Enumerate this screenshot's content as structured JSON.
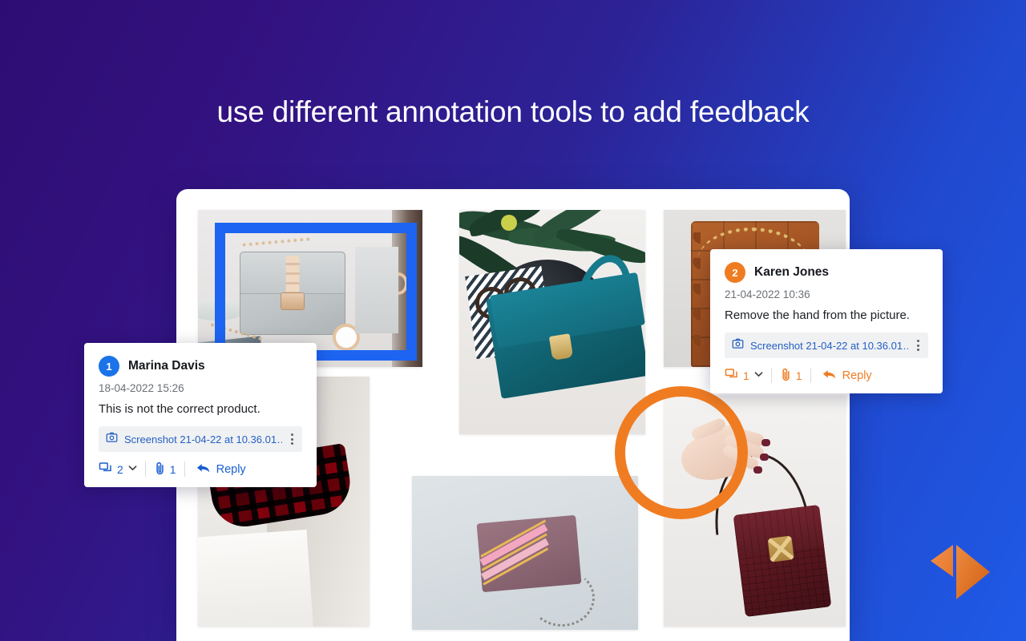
{
  "headline": "use different annotation tools to add feedback",
  "brand": {
    "accent_blue": "#1d64f2",
    "accent_orange": "#f07c22",
    "bg_from": "#2e0d73",
    "bg_to": "#1f5ae6",
    "logo_name": "logo-mark"
  },
  "annotations": [
    {
      "type": "rectangle",
      "color": "#1d64f2",
      "target": "grey-studded-bag-photo"
    },
    {
      "type": "circle",
      "color": "#f07c22",
      "target": "hand-holding-maroon-bag-photo"
    }
  ],
  "gallery": {
    "images": [
      {
        "name": "grey-studded-chain-bag",
        "alt": "Grey studded flap bag with chain on desk"
      },
      {
        "name": "teal-leather-bag",
        "alt": "Teal leather handbag with glasses and plant"
      },
      {
        "name": "brown-woven-tote",
        "alt": "Brown woven leather tote with gold chain"
      },
      {
        "name": "red-plaid-clutch",
        "alt": "Red and black plaid clutch with chain strap"
      },
      {
        "name": "mauve-striped-bag",
        "alt": "Mauve bag with pink and gold chevron stripes"
      },
      {
        "name": "hand-holding-maroon-bag",
        "alt": "Hand holding maroon crocodile pattern bag"
      }
    ]
  },
  "comments": [
    {
      "id": "1",
      "badge": "1",
      "badge_color": "#1a73e8",
      "author": "Marina Davis",
      "timestamp": "18-04-2022 15:26",
      "text": "This is not the correct product.",
      "attachment": {
        "icon": "camera-icon",
        "name": "Screenshot 21-04-22 at 10.36.01…",
        "menu_icon": "kebab-menu-icon"
      },
      "footer": {
        "comments_icon": "comment-bubble-icon",
        "comments_count": "2",
        "chevron": "⌄",
        "attachments_icon": "paperclip-icon",
        "attachments_count": "1",
        "reply_icon": "reply-arrow-icon",
        "reply_label": "Reply"
      }
    },
    {
      "id": "2",
      "badge": "2",
      "badge_color": "#f07c22",
      "author": "Karen Jones",
      "timestamp": "21-04-2022 10:36",
      "text": "Remove the hand from the picture.",
      "attachment": {
        "icon": "camera-icon",
        "name": "Screenshot 21-04-22 at 10.36.01…",
        "menu_icon": "kebab-menu-icon"
      },
      "footer": {
        "comments_icon": "comment-bubble-icon",
        "comments_count": "1",
        "chevron": "⌄",
        "attachments_icon": "paperclip-icon",
        "attachments_count": "1",
        "reply_icon": "reply-arrow-icon",
        "reply_label": "Reply"
      }
    }
  ]
}
